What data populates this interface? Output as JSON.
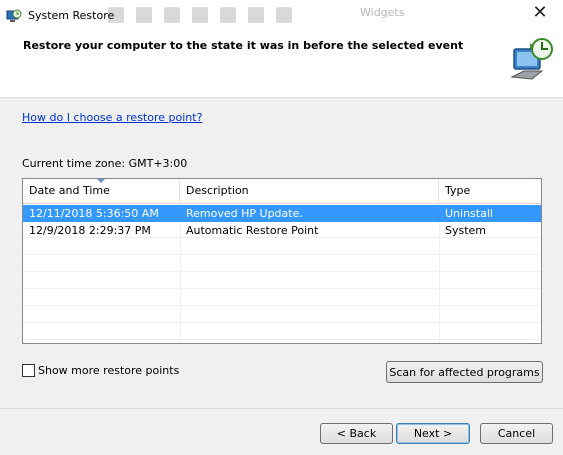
{
  "window": {
    "title": "System Restore",
    "close_glyph": "✕",
    "background_widgets_label": "Widgets"
  },
  "header": {
    "title": "Restore your computer to the state it was in before the selected event"
  },
  "help_link": "How do I choose a restore point?",
  "timezone": "Current time zone: GMT+3:00",
  "restore_list": {
    "columns": [
      "Date and Time",
      "Description",
      "Type"
    ],
    "rows": [
      {
        "date": "12/11/2018 5:36:50 AM",
        "description": "Removed HP Update.",
        "type": "Uninstall",
        "selected": true
      },
      {
        "date": "12/9/2018 2:29:37 PM",
        "description": "Automatic Restore Point",
        "type": "System",
        "selected": false
      }
    ]
  },
  "show_more_label": "Show more restore points",
  "buttons": {
    "scan": "Scan for affected programs",
    "back": "< Back",
    "next": "Next >",
    "cancel": "Cancel"
  },
  "colors": {
    "selection": "#3399ff",
    "link": "#0033cc"
  }
}
